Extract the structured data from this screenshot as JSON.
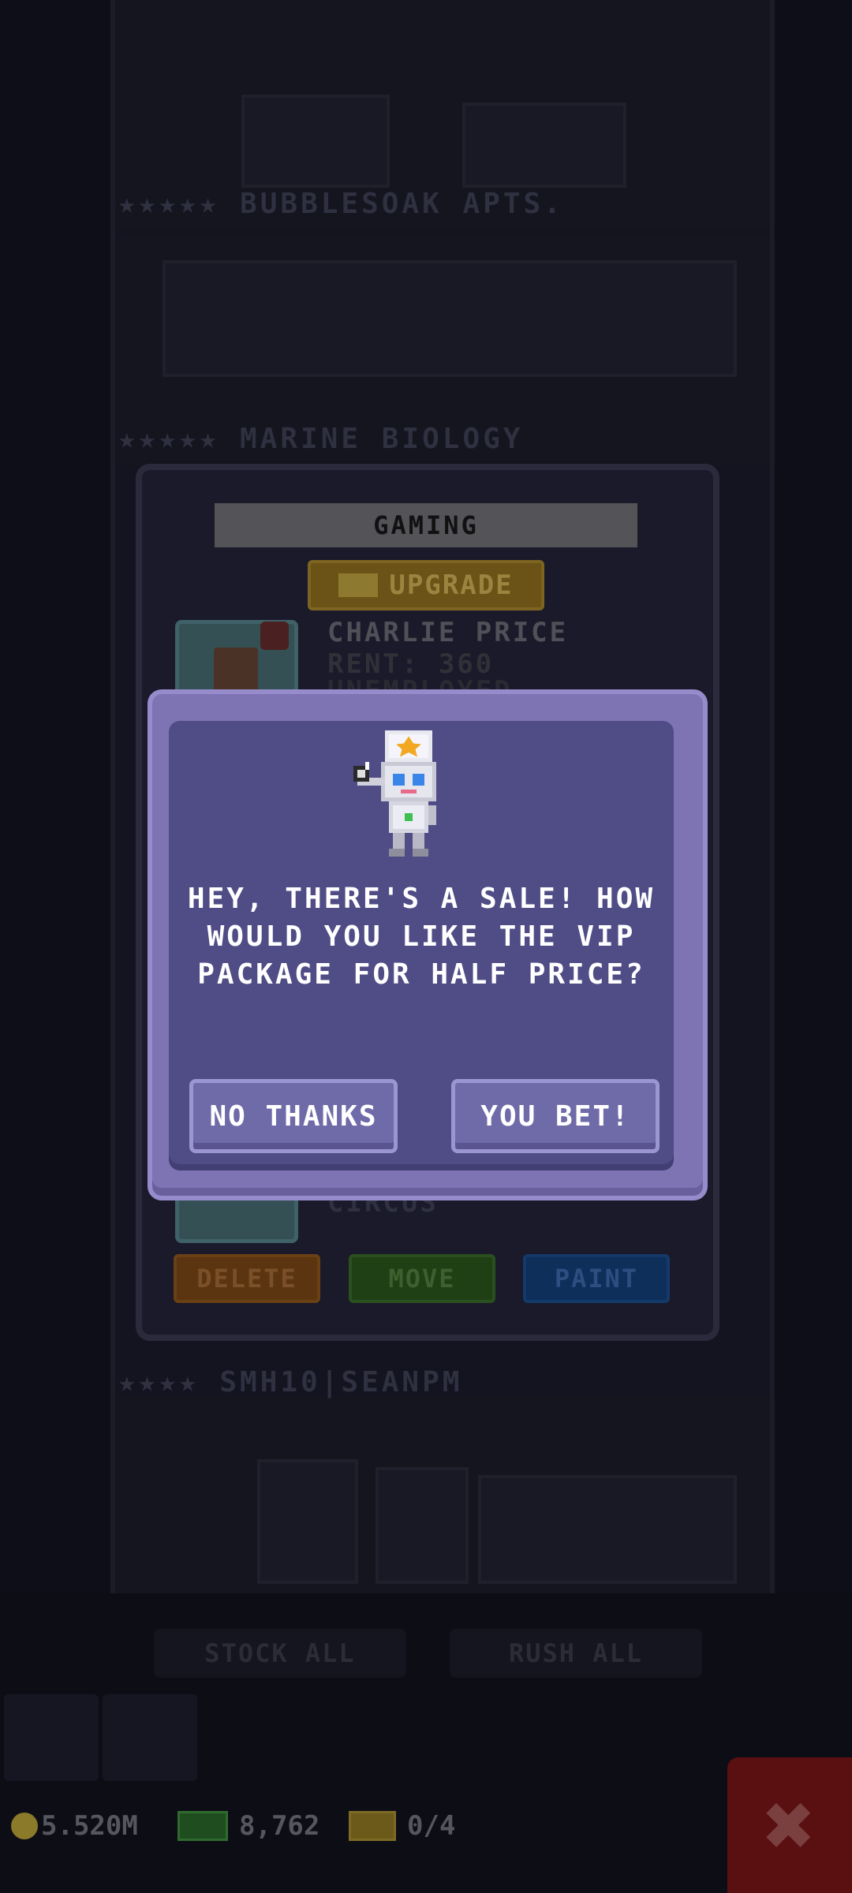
{
  "background": {
    "floors": [
      {
        "label": "★★★★★ BUBBLESOAK APTS."
      },
      {
        "label": "★★★★★ MARINE BIOLOGY"
      },
      {
        "label": "★★★★ SMH10|SEANPM"
      }
    ],
    "actions": {
      "stock_all": "STOCK ALL",
      "rush_all": "RUSH ALL"
    }
  },
  "floor_panel": {
    "title": "GAMING",
    "upgrade_label": "UPGRADE",
    "resident": {
      "name": "CHARLIE PRICE",
      "rent": "RENT: 360",
      "job": "UNEMPLOYED",
      "mood_icon": "sad-face-icon"
    },
    "resident2_job": "CIRCUS",
    "buttons": {
      "delete": "DELETE",
      "move": "MOVE",
      "paint": "PAINT"
    }
  },
  "dialog": {
    "message": "HEY, THERE'S A SALE! HOW WOULD YOU LIKE THE VIP PACKAGE FOR HALF PRICE?",
    "no_label": "NO THANKS",
    "yes_label": "YOU BET!"
  },
  "status": {
    "coins": "5.520M",
    "bux": "8,762",
    "vip": "0/4"
  },
  "colors": {
    "dialog_outer": "#7e73b3",
    "dialog_inner": "#4f4c86",
    "button": "#6f6aa8"
  }
}
